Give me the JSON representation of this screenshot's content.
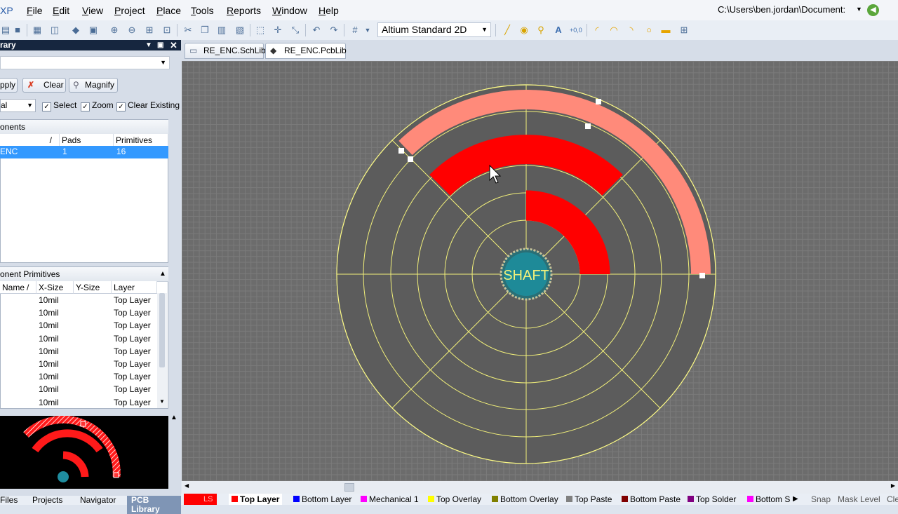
{
  "menu": {
    "app_tag": "XP",
    "items": [
      {
        "label": "File",
        "u": "F",
        "rest": "ile"
      },
      {
        "label": "Edit",
        "u": "E",
        "rest": "dit"
      },
      {
        "label": "View",
        "u": "V",
        "rest": "iew"
      },
      {
        "label": "Project",
        "u": "P",
        "rest": "roject"
      },
      {
        "label": "Place",
        "u": "P",
        "rest": "lace"
      },
      {
        "label": "Tools",
        "u": "T",
        "rest": "ools"
      },
      {
        "label": "Reports",
        "u": "R",
        "rest": "eports"
      },
      {
        "label": "Window",
        "u": "W",
        "rest": "indow"
      },
      {
        "label": "Help",
        "u": "H",
        "rest": "elp"
      }
    ],
    "path": "C:\\Users\\ben.jordan\\Document:"
  },
  "toolbar": {
    "view_mode": "Altium Standard 2D"
  },
  "panel": {
    "title": "rary",
    "buttons": {
      "apply": "Apply",
      "clear": "Clear",
      "magnify": "Magnify"
    },
    "mode": "al",
    "checks": {
      "select": "Select",
      "zoom": "Zoom",
      "clear_existing": "Clear Existing"
    },
    "components_header": "onents",
    "components_cols": {
      "sort": "/",
      "pads": "Pads",
      "primitives": "Primitives"
    },
    "component_row": {
      "name": "ENC",
      "pads": "1",
      "primitives": "16"
    },
    "primitives_header": "onent Primitives",
    "primitives_cols": {
      "name": "Name",
      "sort": "/",
      "xsize": "X-Size",
      "ysize": "Y-Size",
      "layer": "Layer"
    },
    "primitive_rows": [
      {
        "xsize": "10mil",
        "layer": "Top Layer"
      },
      {
        "xsize": "10mil",
        "layer": "Top Layer"
      },
      {
        "xsize": "10mil",
        "layer": "Top Layer"
      },
      {
        "xsize": "10mil",
        "layer": "Top Layer"
      },
      {
        "xsize": "10mil",
        "layer": "Top Layer"
      },
      {
        "xsize": "10mil",
        "layer": "Top Layer"
      },
      {
        "xsize": "10mil",
        "layer": "Top Layer"
      },
      {
        "xsize": "10mil",
        "layer": "Top Layer"
      },
      {
        "xsize": "10mil",
        "layer": "Top Layer"
      }
    ],
    "tabs": [
      "Files",
      "Projects",
      "Navigator",
      "PCB Library"
    ]
  },
  "doc_tabs": [
    {
      "label": "RE_ENC.SchLib"
    },
    {
      "label": "RE_ENC.PcbLib *"
    }
  ],
  "canvas": {
    "pad_label": "SHAFT"
  },
  "layers": {
    "ls_label": "LS",
    "tabs": [
      {
        "label": "Top Layer",
        "color": "#ff0000",
        "active": true
      },
      {
        "label": "Bottom Layer",
        "color": "#0000ff"
      },
      {
        "label": "Mechanical 1",
        "color": "#ff00ff"
      },
      {
        "label": "Top Overlay",
        "color": "#ffff00"
      },
      {
        "label": "Bottom Overlay",
        "color": "#808000"
      },
      {
        "label": "Top Paste",
        "color": "#808080"
      },
      {
        "label": "Bottom Paste",
        "color": "#800000"
      },
      {
        "label": "Top Solder",
        "color": "#800080"
      },
      {
        "label": "Bottom S",
        "color": "#ff00ff"
      }
    ],
    "snap": "Snap",
    "mask_level": "Mask Level",
    "clear": "Cle"
  },
  "colors": {
    "top_layer": "#ff0000",
    "selected_track": "#ff8a7a",
    "overlay": "#ffff66",
    "canvas_bg": "#6c6c6c"
  }
}
